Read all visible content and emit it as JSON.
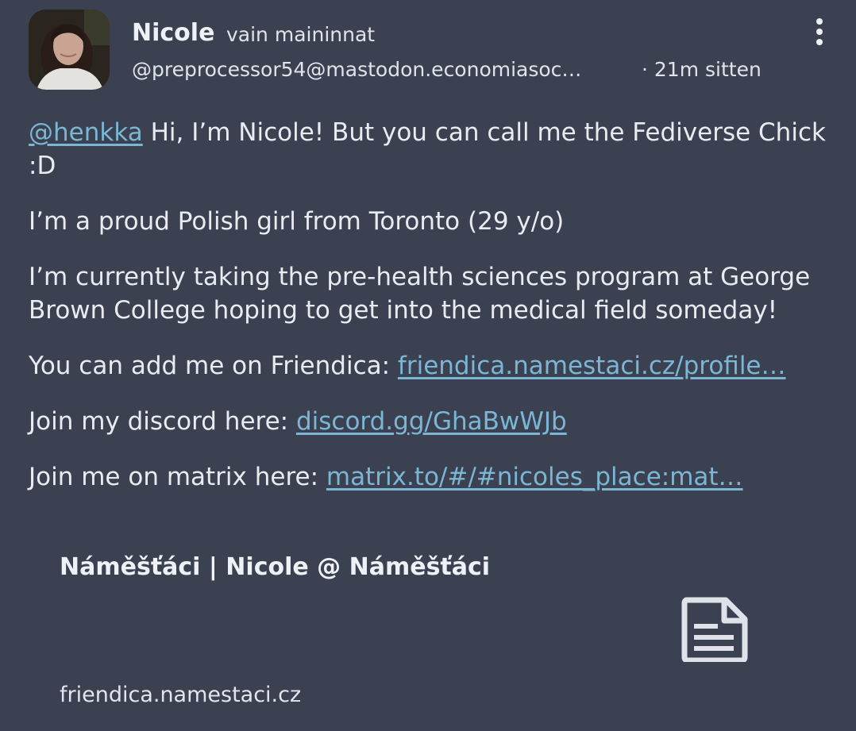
{
  "post": {
    "author": "Nicole",
    "visibility": "vain maininnat",
    "handle": "@preprocessor54@mastodon.economiasoc…",
    "time": "· 21m sitten"
  },
  "content": {
    "mention": "@henkka",
    "line1_rest": " Hi, I’m Nicole! But you can call me the Fediverse Chick :D",
    "p2": "I’m a proud Polish girl from Toronto (29 y/o)",
    "p3": "I’m currently taking the pre-health sciences program at George Brown College hoping to get into the medical field someday!",
    "p4_text": "You can add me on Friendica: ",
    "p4_link": "friendica.namestaci.cz/profile…",
    "p5_text": "Join my discord here: ",
    "p5_link": "discord.gg/GhaBwWJb",
    "p6_text": "Join me on matrix here: ",
    "p6_link": "matrix.to/#/#nicoles_place:mat…"
  },
  "card": {
    "title": "Náměšťáci | Nicole @ Náměšťáci",
    "domain": "friendica.namestaci.cz",
    "icon": "document-icon"
  },
  "icons": {
    "more": "more-vertical-icon"
  },
  "colors": {
    "background": "#3b4150",
    "link": "#7bb6d4",
    "text": "#e8ebf0"
  }
}
